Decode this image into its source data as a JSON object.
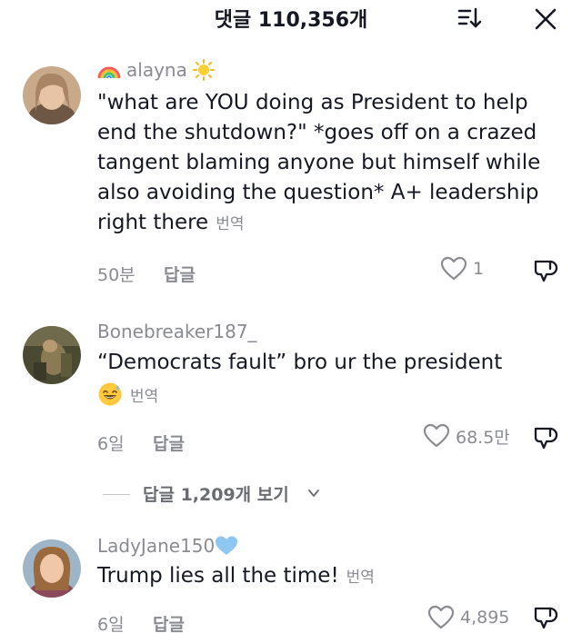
{
  "header": {
    "title": "댓글 110,356개"
  },
  "comments": [
    {
      "username": "alayna",
      "text": "\"what are YOU doing as President to help end the shutdown?\" *goes off on a crazed tangent blaming anyone but himself while also avoiding the question* A+ leadership right there",
      "translate": "번역",
      "time": "50분",
      "reply": "답글",
      "likes": "1"
    },
    {
      "username": "Bonebreaker187_",
      "text": "“Democrats fault” bro ur the president",
      "translate": "번역",
      "time": "6일",
      "reply": "답글",
      "likes": "68.5만"
    },
    {
      "username": "LadyJane150",
      "text": "Trump lies all the time!",
      "translate": "번역",
      "time": "6일",
      "reply": "답글",
      "likes": "4,895"
    }
  ],
  "view_replies": {
    "label": "답글 1,209개 보기"
  },
  "icons": [
    "sort-icon",
    "close-icon",
    "rainbow-emoji-icon",
    "sun-emoji-icon",
    "heart-icon",
    "dislike-icon",
    "grinning-sweat-emoji-icon",
    "blue-heart-emoji-icon",
    "chevron-down-icon"
  ],
  "colors": {
    "text": "#161823",
    "secondary": "#8a8b91",
    "background": "#ffffff"
  }
}
